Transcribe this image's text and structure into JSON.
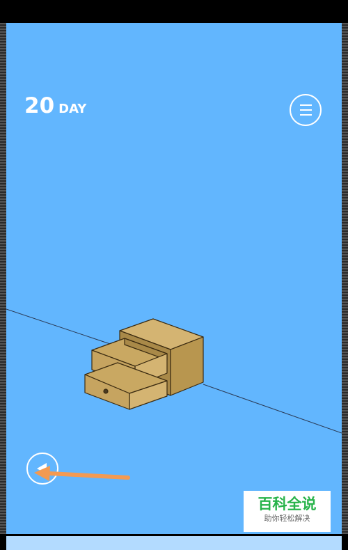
{
  "hud": {
    "day_number": "20",
    "day_label": "DAY"
  },
  "icons": {
    "menu": "hamburger-menu-icon",
    "back": "back-triangle-icon",
    "hint": "orange-arrow-icon"
  },
  "scene": {
    "object": "drawer-cabinet-icon",
    "drawers_open": 2
  },
  "watermark": {
    "title": "百科全说",
    "subtitle": "助你轻松解决"
  },
  "colors": {
    "background": "#62b6fe",
    "wood": "#c6a460",
    "wood_dark": "#a98948",
    "wood_light": "#d4b472",
    "hint_arrow": "#f39a52",
    "watermark_text": "#27b34a"
  }
}
